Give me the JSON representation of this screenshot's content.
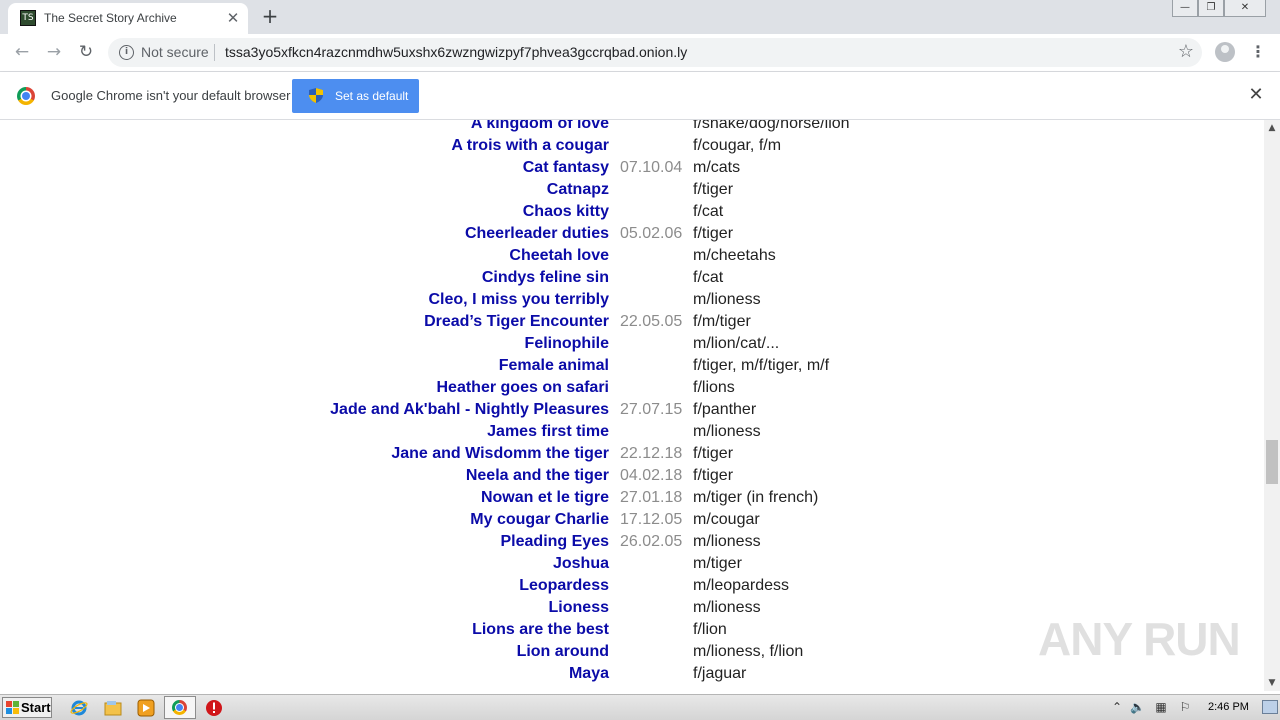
{
  "browser": {
    "tab_title": "The Secret Story Archive",
    "tab_favicon_text": "TS",
    "new_tab_symbol": "+",
    "close_tab_symbol": "✕",
    "window_controls": {
      "minimize": "—",
      "restore": "❐",
      "close": "✕"
    },
    "nav": {
      "back": "←",
      "forward": "→",
      "reload": "↻"
    },
    "security_label": "Not secure",
    "url": "tssa3yo5xfkcn4razcnmdhw5uxshx6zwzngwizpyf7phvea3gccrqbad.onion.ly",
    "bookmark_star": "☆",
    "menu_symbol": "⋮"
  },
  "infobar": {
    "message": "Google Chrome isn't your default browser",
    "button_label": "Set as default",
    "close_symbol": "✕"
  },
  "stories": [
    {
      "title": "A kingdom of love",
      "date": "",
      "tags": "f/snake/dog/horse/lion"
    },
    {
      "title": "A trois with a cougar",
      "date": "",
      "tags": "f/cougar, f/m"
    },
    {
      "title": "Cat fantasy",
      "date": "07.10.04",
      "tags": "m/cats"
    },
    {
      "title": "Catnapz",
      "date": "",
      "tags": "f/tiger"
    },
    {
      "title": "Chaos kitty",
      "date": "",
      "tags": "f/cat"
    },
    {
      "title": "Cheerleader duties",
      "date": "05.02.06",
      "tags": "f/tiger"
    },
    {
      "title": "Cheetah love",
      "date": "",
      "tags": "m/cheetahs"
    },
    {
      "title": "Cindys feline sin",
      "date": "",
      "tags": "f/cat"
    },
    {
      "title": "Cleo, I miss you terribly",
      "date": "",
      "tags": "m/lioness"
    },
    {
      "title": "Dread’s Tiger Encounter",
      "date": "22.05.05",
      "tags": "f/m/tiger"
    },
    {
      "title": "Felinophile",
      "date": "",
      "tags": "m/lion/cat/..."
    },
    {
      "title": "Female animal",
      "date": "",
      "tags": "f/tiger, m/f/tiger, m/f"
    },
    {
      "title": "Heather goes on safari",
      "date": "",
      "tags": "f/lions"
    },
    {
      "title": "Jade and Ak'bahl - Nightly Pleasures",
      "date": "27.07.15",
      "tags": "f/panther"
    },
    {
      "title": "James first time",
      "date": "",
      "tags": "m/lioness"
    },
    {
      "title": "Jane and Wisdomm the tiger",
      "date": "22.12.18",
      "tags": "f/tiger"
    },
    {
      "title": "Neela and the tiger",
      "date": "04.02.18",
      "tags": "f/tiger"
    },
    {
      "title": "Nowan et le tigre",
      "date": "27.01.18",
      "tags": "m/tiger (in french)"
    },
    {
      "title": "My cougar Charlie",
      "date": "17.12.05",
      "tags": "m/cougar"
    },
    {
      "title": "Pleading Eyes",
      "date": "26.02.05",
      "tags": "m/lioness"
    },
    {
      "title": "Joshua",
      "date": "",
      "tags": "m/tiger"
    },
    {
      "title": "Leopardess",
      "date": "",
      "tags": "m/leopardess"
    },
    {
      "title": "Lioness",
      "date": "",
      "tags": "m/lioness"
    },
    {
      "title": "Lions are the best",
      "date": "",
      "tags": "f/lion"
    },
    {
      "title": "Lion around",
      "date": "",
      "tags": "m/lioness, f/lion"
    },
    {
      "title": "Maya",
      "date": "",
      "tags": "f/jaguar"
    }
  ],
  "watermark": "ANY RUN",
  "taskbar": {
    "start_label": "Start",
    "clock": "2:46 PM"
  }
}
